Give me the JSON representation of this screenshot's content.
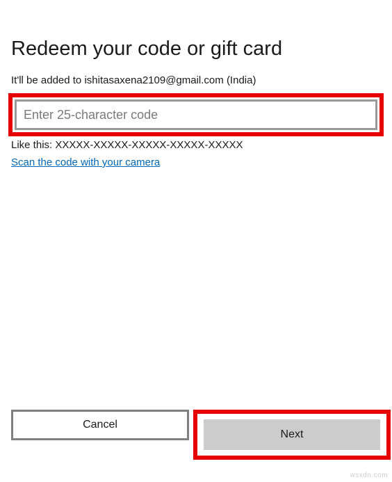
{
  "page": {
    "title": "Redeem your code or gift card",
    "account_line": "It'll be added to ishitasaxena2109@gmail.com (India)",
    "code_placeholder": "Enter 25-character code",
    "hint": "Like this: XXXXX-XXXXX-XXXXX-XXXXX-XXXXX",
    "scan_link": "Scan the code with your camera"
  },
  "buttons": {
    "cancel": "Cancel",
    "next": "Next"
  },
  "watermark": "wsxdn.com",
  "colors": {
    "highlight": "#e60000",
    "link": "#0067b8",
    "border_gray": "#999999",
    "button_gray": "#cccccc"
  }
}
